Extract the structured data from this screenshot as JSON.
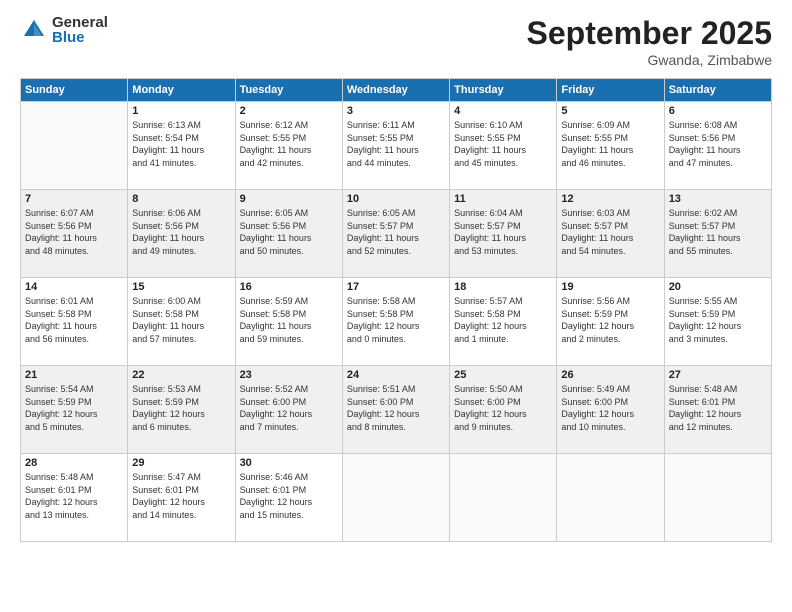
{
  "header": {
    "logo_general": "General",
    "logo_blue": "Blue",
    "month_title": "September 2025",
    "location": "Gwanda, Zimbabwe"
  },
  "weekdays": [
    "Sunday",
    "Monday",
    "Tuesday",
    "Wednesday",
    "Thursday",
    "Friday",
    "Saturday"
  ],
  "weeks": [
    [
      {
        "day": "",
        "info": ""
      },
      {
        "day": "1",
        "info": "Sunrise: 6:13 AM\nSunset: 5:54 PM\nDaylight: 11 hours\nand 41 minutes."
      },
      {
        "day": "2",
        "info": "Sunrise: 6:12 AM\nSunset: 5:55 PM\nDaylight: 11 hours\nand 42 minutes."
      },
      {
        "day": "3",
        "info": "Sunrise: 6:11 AM\nSunset: 5:55 PM\nDaylight: 11 hours\nand 44 minutes."
      },
      {
        "day": "4",
        "info": "Sunrise: 6:10 AM\nSunset: 5:55 PM\nDaylight: 11 hours\nand 45 minutes."
      },
      {
        "day": "5",
        "info": "Sunrise: 6:09 AM\nSunset: 5:55 PM\nDaylight: 11 hours\nand 46 minutes."
      },
      {
        "day": "6",
        "info": "Sunrise: 6:08 AM\nSunset: 5:56 PM\nDaylight: 11 hours\nand 47 minutes."
      }
    ],
    [
      {
        "day": "7",
        "info": "Sunrise: 6:07 AM\nSunset: 5:56 PM\nDaylight: 11 hours\nand 48 minutes."
      },
      {
        "day": "8",
        "info": "Sunrise: 6:06 AM\nSunset: 5:56 PM\nDaylight: 11 hours\nand 49 minutes."
      },
      {
        "day": "9",
        "info": "Sunrise: 6:05 AM\nSunset: 5:56 PM\nDaylight: 11 hours\nand 50 minutes."
      },
      {
        "day": "10",
        "info": "Sunrise: 6:05 AM\nSunset: 5:57 PM\nDaylight: 11 hours\nand 52 minutes."
      },
      {
        "day": "11",
        "info": "Sunrise: 6:04 AM\nSunset: 5:57 PM\nDaylight: 11 hours\nand 53 minutes."
      },
      {
        "day": "12",
        "info": "Sunrise: 6:03 AM\nSunset: 5:57 PM\nDaylight: 11 hours\nand 54 minutes."
      },
      {
        "day": "13",
        "info": "Sunrise: 6:02 AM\nSunset: 5:57 PM\nDaylight: 11 hours\nand 55 minutes."
      }
    ],
    [
      {
        "day": "14",
        "info": "Sunrise: 6:01 AM\nSunset: 5:58 PM\nDaylight: 11 hours\nand 56 minutes."
      },
      {
        "day": "15",
        "info": "Sunrise: 6:00 AM\nSunset: 5:58 PM\nDaylight: 11 hours\nand 57 minutes."
      },
      {
        "day": "16",
        "info": "Sunrise: 5:59 AM\nSunset: 5:58 PM\nDaylight: 11 hours\nand 59 minutes."
      },
      {
        "day": "17",
        "info": "Sunrise: 5:58 AM\nSunset: 5:58 PM\nDaylight: 12 hours\nand 0 minutes."
      },
      {
        "day": "18",
        "info": "Sunrise: 5:57 AM\nSunset: 5:58 PM\nDaylight: 12 hours\nand 1 minute."
      },
      {
        "day": "19",
        "info": "Sunrise: 5:56 AM\nSunset: 5:59 PM\nDaylight: 12 hours\nand 2 minutes."
      },
      {
        "day": "20",
        "info": "Sunrise: 5:55 AM\nSunset: 5:59 PM\nDaylight: 12 hours\nand 3 minutes."
      }
    ],
    [
      {
        "day": "21",
        "info": "Sunrise: 5:54 AM\nSunset: 5:59 PM\nDaylight: 12 hours\nand 5 minutes."
      },
      {
        "day": "22",
        "info": "Sunrise: 5:53 AM\nSunset: 5:59 PM\nDaylight: 12 hours\nand 6 minutes."
      },
      {
        "day": "23",
        "info": "Sunrise: 5:52 AM\nSunset: 6:00 PM\nDaylight: 12 hours\nand 7 minutes."
      },
      {
        "day": "24",
        "info": "Sunrise: 5:51 AM\nSunset: 6:00 PM\nDaylight: 12 hours\nand 8 minutes."
      },
      {
        "day": "25",
        "info": "Sunrise: 5:50 AM\nSunset: 6:00 PM\nDaylight: 12 hours\nand 9 minutes."
      },
      {
        "day": "26",
        "info": "Sunrise: 5:49 AM\nSunset: 6:00 PM\nDaylight: 12 hours\nand 10 minutes."
      },
      {
        "day": "27",
        "info": "Sunrise: 5:48 AM\nSunset: 6:01 PM\nDaylight: 12 hours\nand 12 minutes."
      }
    ],
    [
      {
        "day": "28",
        "info": "Sunrise: 5:48 AM\nSunset: 6:01 PM\nDaylight: 12 hours\nand 13 minutes."
      },
      {
        "day": "29",
        "info": "Sunrise: 5:47 AM\nSunset: 6:01 PM\nDaylight: 12 hours\nand 14 minutes."
      },
      {
        "day": "30",
        "info": "Sunrise: 5:46 AM\nSunset: 6:01 PM\nDaylight: 12 hours\nand 15 minutes."
      },
      {
        "day": "",
        "info": ""
      },
      {
        "day": "",
        "info": ""
      },
      {
        "day": "",
        "info": ""
      },
      {
        "day": "",
        "info": ""
      }
    ]
  ]
}
